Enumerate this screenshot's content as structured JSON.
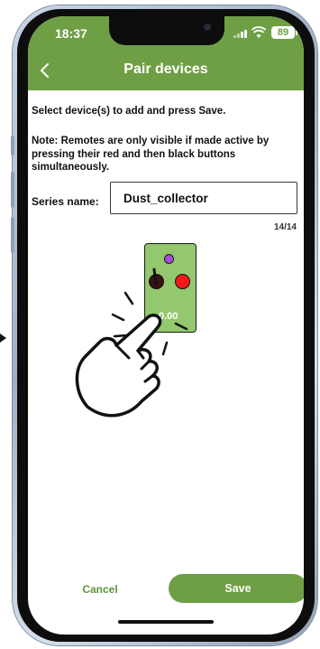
{
  "status_bar": {
    "time": "18:37",
    "battery": "89"
  },
  "header": {
    "title": "Pair devices",
    "back_icon": "chevron-left-icon"
  },
  "content": {
    "instruction": "Select device(s) to add and press Save.",
    "note": "Note: Remotes are only visible if made active by pressing their red and then black buttons simultaneously.",
    "series_label": "Series name:",
    "series_value": "Dust_collector",
    "char_count": "14/14"
  },
  "illustration": {
    "remote_readout": "0.00",
    "led_color": "#a64dd6",
    "red_button_color": "#ee1a1a",
    "black_button_color": "#3a1010",
    "icons": [
      "hand-pointer-icon",
      "remote-icon"
    ]
  },
  "actions": {
    "cancel_label": "Cancel",
    "save_label": "Save"
  },
  "colors": {
    "accent": "#6f9f45",
    "remote_body": "#93c86e"
  }
}
